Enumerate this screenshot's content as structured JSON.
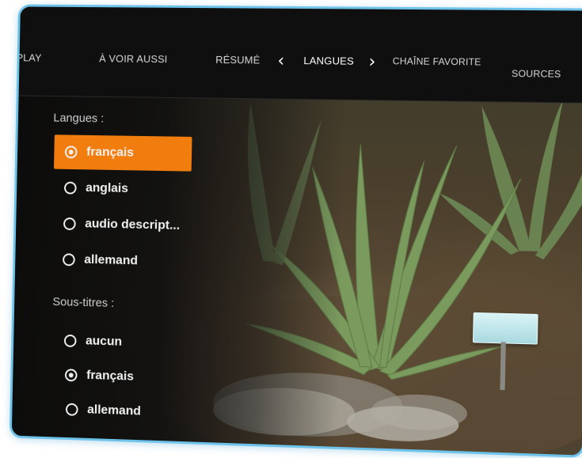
{
  "nav": {
    "items": [
      {
        "label": "PLAY"
      },
      {
        "label": "À VOIR AUSSI"
      },
      {
        "label": "RÉSUMÉ"
      },
      {
        "label": "LANGUES",
        "active": true
      },
      {
        "label": "CHAÎNE FAVORITE"
      },
      {
        "label": "SOURCES"
      }
    ],
    "prev_icon": "chevron-left-icon",
    "next_icon": "chevron-right-icon"
  },
  "audio": {
    "title": "Langues :",
    "options": [
      {
        "label": "français",
        "selected": true
      },
      {
        "label": "anglais",
        "selected": false
      },
      {
        "label": "audio descript...",
        "selected": false
      },
      {
        "label": "allemand",
        "selected": false
      }
    ]
  },
  "subtitles": {
    "title": "Sous-titres :",
    "options": [
      {
        "label": "aucun",
        "selected": false
      },
      {
        "label": "français",
        "selected": true
      },
      {
        "label": "allemand",
        "selected": false
      }
    ]
  },
  "colors": {
    "accent": "#f17d0f",
    "frame": "#6ec3ea"
  }
}
